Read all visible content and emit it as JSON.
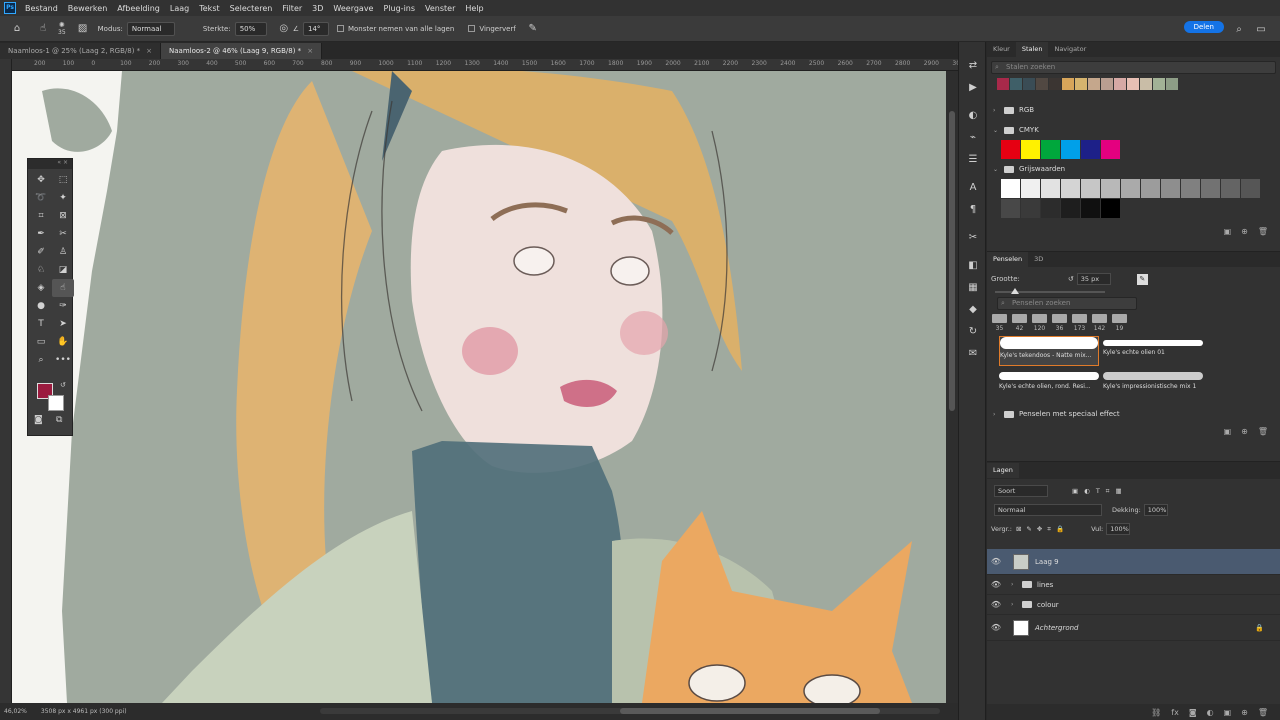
{
  "menubar": {
    "logo": "Ps",
    "items": [
      "Bestand",
      "Bewerken",
      "Afbeelding",
      "Laag",
      "Tekst",
      "Selecteren",
      "Filter",
      "3D",
      "Weergave",
      "Plug-ins",
      "Venster",
      "Help"
    ]
  },
  "options": {
    "brush_size": "35",
    "mode_label": "Modus:",
    "mode_value": "Normaal",
    "strength_label": "Sterkte:",
    "strength_value": "50%",
    "angle_value": "14°",
    "sample_all_label": "Monster nemen van alle lagen",
    "finger_paint_label": "Vingerverf",
    "share_label": "Delen"
  },
  "doc_tabs": [
    {
      "label": "Naamloos-1 @ 25% (Laag 2, RGB/8) *"
    },
    {
      "label": "Naamloos-2 @ 46% (Laag 9, RGB/8) *"
    }
  ],
  "ruler_marks": [
    "200",
    "100",
    "0",
    "100",
    "200",
    "300",
    "400",
    "500",
    "600",
    "700",
    "800",
    "900",
    "1000",
    "1100",
    "1200",
    "1300",
    "1400",
    "1500",
    "1600",
    "1700",
    "1800",
    "1900",
    "2000",
    "2100",
    "2200",
    "2300",
    "2400",
    "2500",
    "2600",
    "2700",
    "2800",
    "2900",
    "3000"
  ],
  "status": {
    "zoom": "46,02%",
    "doc_size": "3508 px x 4961 px (300 ppi)"
  },
  "swatches_panel": {
    "tabs": [
      "Kleur",
      "Stalen",
      "Navigator"
    ],
    "active_tab": "Stalen",
    "search_placeholder": "Stalen zoeken",
    "recent": [
      "#a8294a",
      "#3f5f68",
      "#3a4c55",
      "#514842",
      "#3b3532",
      "#d7a55a",
      "#d6b46e",
      "#c5a78c",
      "#b99e91",
      "#d6a9a5",
      "#e7bfb4",
      "#c9bda7",
      "#a2b296",
      "#8d9d86"
    ],
    "groups": [
      {
        "name": "RGB"
      },
      {
        "name": "CMYK",
        "colors": [
          "#e60012",
          "#fff100",
          "#00a73c",
          "#00a0e9",
          "#1d2088",
          "#e4007f"
        ]
      },
      {
        "name": "Grijswaarden",
        "colors": [
          "#ffffff",
          "#f0f0f0",
          "#e2e2e2",
          "#d4d4d4",
          "#c6c6c6",
          "#b8b8b8",
          "#aaaaaa",
          "#9c9c9c",
          "#8e8e8e",
          "#808080",
          "#727272",
          "#646464",
          "#565656",
          "#484848",
          "#3a3a3a",
          "#2c2c2c",
          "#1e1e1e",
          "#101010",
          "#000000"
        ]
      }
    ]
  },
  "brushes_panel": {
    "tabs": [
      "Penselen",
      "3D"
    ],
    "size_label": "Grootte:",
    "size_value": "35 px",
    "search_placeholder": "Penselen zoeken",
    "tip_sizes": [
      "35",
      "42",
      "120",
      "36",
      "173",
      "142",
      "19"
    ],
    "brushes": [
      {
        "label": "Kyle's tekendoos - Natte mix..."
      },
      {
        "label": "Kyle's echte olien 01"
      },
      {
        "label": "Kyle's echte olien, rond. Resi..."
      },
      {
        "label": "Kyle's impressionistische mix 1"
      }
    ],
    "group_special": "Penselen met speciaal effect"
  },
  "layers_panel": {
    "title": "Lagen",
    "filter": "Soort",
    "blend": "Normaal",
    "opacity_label": "Dekking:",
    "opacity_value": "100%",
    "lock_label": "Vergr.:",
    "fill_label": "Vul:",
    "fill_value": "100%",
    "layers": [
      {
        "name": "Laag 9",
        "selected": true
      },
      {
        "name": "lines",
        "folder": true
      },
      {
        "name": "colour",
        "folder": true
      },
      {
        "name": "Achtergrond",
        "locked": true
      }
    ]
  }
}
